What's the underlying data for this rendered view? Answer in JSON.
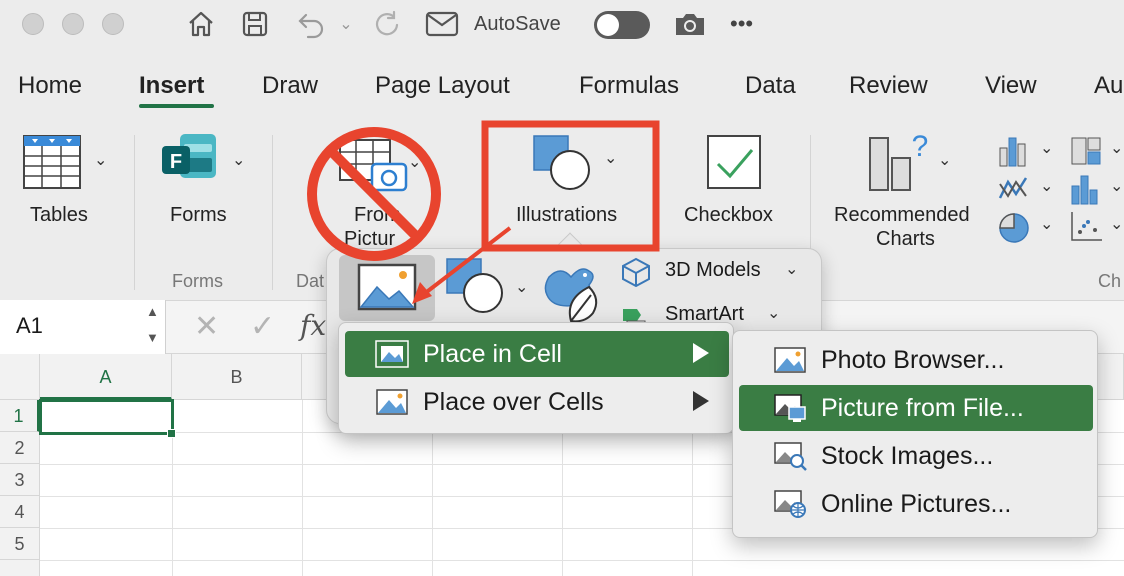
{
  "titlebar": {
    "autosave_label": "AutoSave",
    "more": "•••"
  },
  "tabs": [
    "Home",
    "Insert",
    "Draw",
    "Page Layout",
    "Formulas",
    "Data",
    "Review",
    "View",
    "Au"
  ],
  "ribbon": {
    "tables": "Tables",
    "forms": "Forms",
    "forms_group": "Forms",
    "data_group": "Dat",
    "from_picture_1": "From",
    "from_picture_2": "Pictur",
    "illustrations": "Illustrations",
    "checkbox": "Checkbox",
    "recommended_1": "Recommended",
    "recommended_2": "Charts",
    "charts_group": "Ch"
  },
  "popover": {
    "models": "3D Models",
    "smartart": "SmartArt"
  },
  "formula_bar": {
    "cell_ref": "A1",
    "fx": "fx"
  },
  "grid": {
    "columns": [
      "A",
      "B"
    ],
    "rows": [
      "1",
      "2",
      "3",
      "4",
      "5"
    ]
  },
  "picture_menu": [
    {
      "label": "Place in Cell",
      "selected": true
    },
    {
      "label": "Place over Cells",
      "selected": false
    }
  ],
  "submenu": [
    {
      "label": "Photo Browser...",
      "icon": "photo-browser-icon",
      "selected": false
    },
    {
      "label": "Picture from File...",
      "icon": "picture-file-icon",
      "selected": true
    },
    {
      "label": "Stock Images...",
      "icon": "stock-images-icon",
      "selected": false
    },
    {
      "label": "Online Pictures...",
      "icon": "online-pictures-icon",
      "selected": false
    }
  ],
  "colors": {
    "accent_green": "#217346",
    "menu_selected": "#3a7d44",
    "annotation_red": "#e8442e"
  }
}
